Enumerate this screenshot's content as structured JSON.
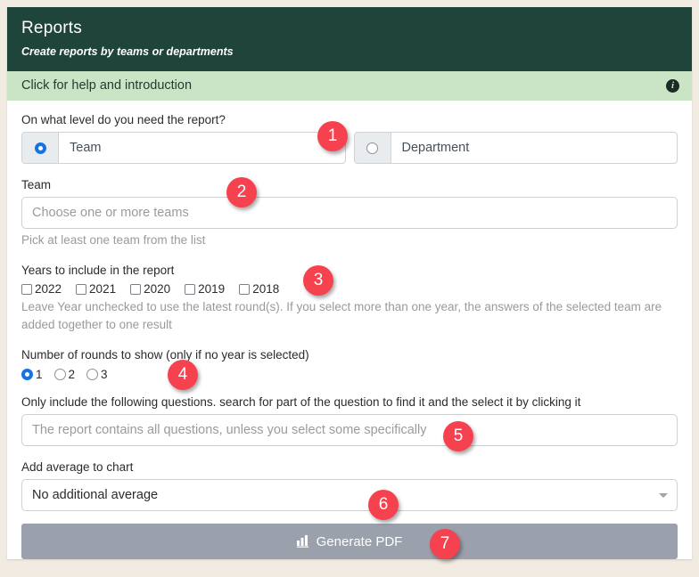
{
  "header": {
    "title": "Reports",
    "subtitle": "Create reports by teams or departments",
    "help_bar_text": "Click for help and introduction",
    "info_icon": "info-icon",
    "bg_color": "#1f443a",
    "help_bar_color": "#c9e5c5"
  },
  "level": {
    "label": "On what level do you need the report?",
    "options": [
      {
        "label": "Team",
        "selected": true
      },
      {
        "label": "Department",
        "selected": false
      }
    ]
  },
  "team": {
    "label": "Team",
    "placeholder": "Choose one or more teams",
    "value": "",
    "help": "Pick at least one team from the list"
  },
  "years": {
    "label": "Years to include in the report",
    "options": [
      {
        "label": "2022",
        "checked": false
      },
      {
        "label": "2021",
        "checked": false
      },
      {
        "label": "2020",
        "checked": false
      },
      {
        "label": "2019",
        "checked": false
      },
      {
        "label": "2018",
        "checked": false
      }
    ],
    "help": "Leave Year unchecked to use the latest round(s). If you select more than one year, the answers of the selected team are added together to one result"
  },
  "rounds": {
    "label": "Number of rounds to show (only if no year is selected)",
    "options": [
      {
        "label": "1",
        "selected": true
      },
      {
        "label": "2",
        "selected": false
      },
      {
        "label": "3",
        "selected": false
      }
    ]
  },
  "questions": {
    "label": "Only include the following questions. search for part of the question to find it and the select it by clicking it",
    "placeholder": "The report contains all questions, unless you select some specifically",
    "value": ""
  },
  "average": {
    "label": "Add average to chart",
    "selected": "No additional average",
    "caret_icon": "chevron-down-icon"
  },
  "generate": {
    "label": "Generate PDF",
    "icon": "bar-chart-icon",
    "disabled": true,
    "color": "#9aa1ac"
  },
  "badges": [
    {
      "number": "1"
    },
    {
      "number": "2"
    },
    {
      "number": "3"
    },
    {
      "number": "4"
    },
    {
      "number": "5"
    },
    {
      "number": "6"
    },
    {
      "number": "7"
    }
  ],
  "badge_color": "#f6414e"
}
